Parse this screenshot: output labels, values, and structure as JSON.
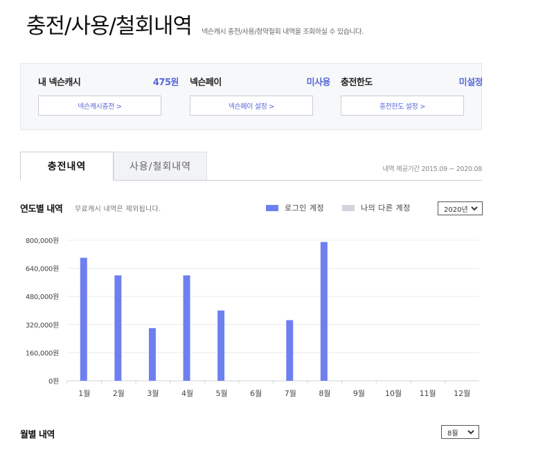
{
  "header": {
    "title": "충전/사용/철회내역",
    "subtitle": "넥슨캐시 충전/사용/청약철회 내역을 조회하실 수 있습니다."
  },
  "summary": [
    {
      "label": "내 넥슨캐시",
      "value": "475원",
      "button": "넥슨캐시충전 >"
    },
    {
      "label": "넥슨페이",
      "value": "미사용",
      "button": "넥슨페이 설정 >"
    },
    {
      "label": "충전한도",
      "value": "미설정",
      "button": "충전한도 설정 >"
    }
  ],
  "tabs": [
    {
      "label": "충전내역",
      "active": true
    },
    {
      "label": "사용/철회내역",
      "active": false
    }
  ],
  "period_text": "내역 제공기간 2015.09 ~ 2020.08",
  "yearly": {
    "title": "연도별 내역",
    "note": "무료캐시 내역은 제외됩니다.",
    "legend": [
      {
        "label": "로그인 계정",
        "color": "#6e7ff0"
      },
      {
        "label": "나의 다른 계정",
        "color": "#d3d5de"
      }
    ],
    "year_select": "2020년"
  },
  "chart_data": {
    "type": "bar",
    "categories": [
      "1월",
      "2월",
      "3월",
      "4월",
      "5월",
      "6월",
      "7월",
      "8월",
      "9월",
      "10월",
      "11월",
      "12월"
    ],
    "series": [
      {
        "name": "로그인 계정",
        "color": "#6e7ff0",
        "values": [
          700000,
          600000,
          300000,
          600000,
          400000,
          0,
          345000,
          790000,
          0,
          0,
          0,
          0
        ]
      }
    ],
    "y_ticks": [
      "0원",
      "160,000원",
      "320,000원",
      "480,000원",
      "640,000원",
      "800,000원"
    ],
    "ylim": [
      0,
      800000
    ],
    "grid": true
  },
  "monthly": {
    "title": "월별 내역",
    "month_select": "8월"
  }
}
